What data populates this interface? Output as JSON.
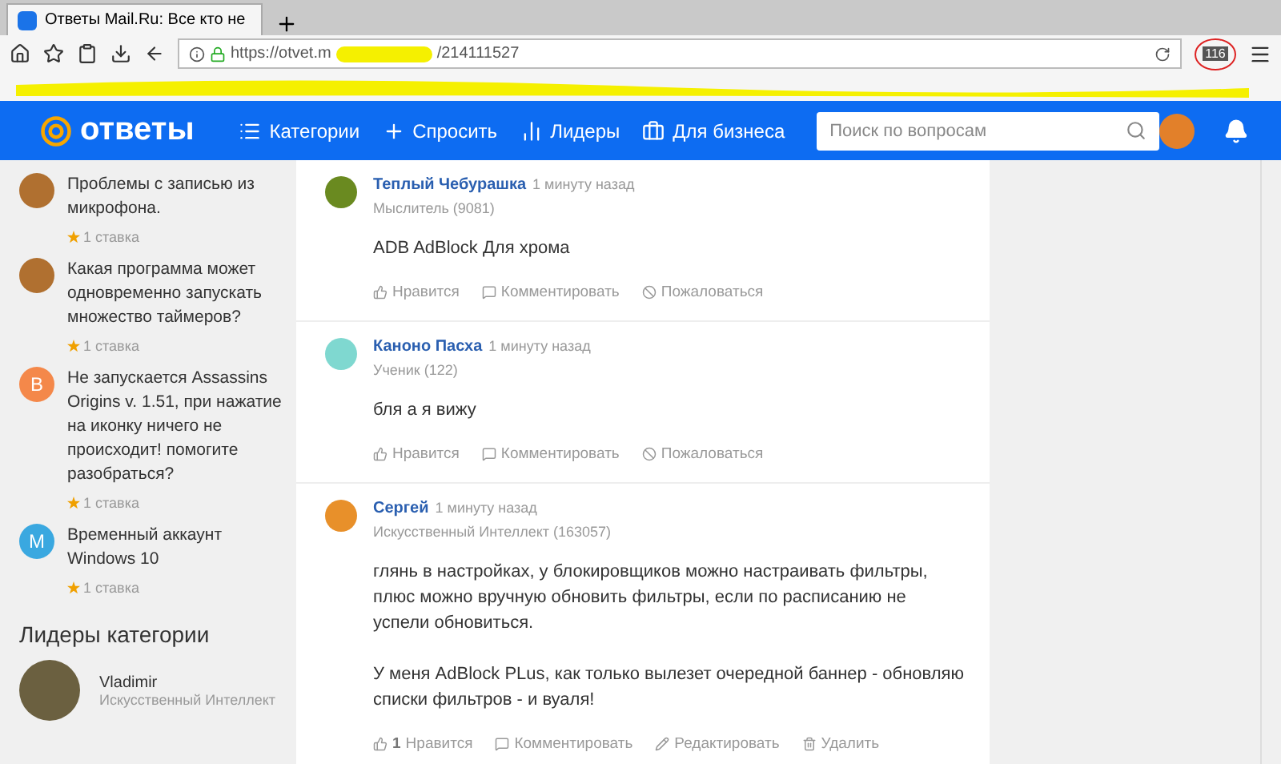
{
  "browser": {
    "tab_title": "Ответы Mail.Ru: Все кто не",
    "url_start": "https://otvet.m",
    "url_end": "/214111527",
    "extension_badge": "116"
  },
  "header": {
    "logo": "ответы",
    "nav": [
      {
        "label": "Категории",
        "kind": "list"
      },
      {
        "label": "Спросить",
        "kind": "plus"
      },
      {
        "label": "Лидеры",
        "kind": "bars"
      },
      {
        "label": "Для бизнеса",
        "kind": "bag"
      }
    ],
    "search": {
      "placeholder": "Поиск по вопросам"
    }
  },
  "sidebar": {
    "questions": [
      {
        "title": "Проблемы с записью из микрофона.",
        "bets": "1 ставка",
        "kind": "photo"
      },
      {
        "title": "Какая программа может одновременно запускать множество таймеров?",
        "bets": "1 ставка",
        "kind": "photo"
      },
      {
        "title": "Не запускается Assassins Origins v. 1.51, при нажатие на иконку ничего не происходит! помогите разобраться?",
        "bets": "1 ставка",
        "kind": "letter",
        "letter": "В",
        "color": "#f4884a"
      },
      {
        "title": "Временный аккаунт Windows 10",
        "bets": "1 ставка",
        "kind": "letter",
        "letter": "М",
        "color": "#3aa8e0"
      }
    ],
    "leaders_title": "Лидеры категории",
    "leaders": [
      {
        "name": "Vladimir",
        "rank": "Искусственный Интеллект"
      }
    ]
  },
  "answers": [
    {
      "author": "Теплый Чебурашка",
      "time": "1 минуту назад",
      "rank": "Мыслитель (9081)",
      "text": [
        "ADB AdBlock Для хрома"
      ],
      "actions": [
        {
          "kind": "like",
          "label": "Нравится"
        },
        {
          "kind": "comment",
          "label": "Комментировать"
        },
        {
          "kind": "report",
          "label": "Пожаловаться"
        }
      ]
    },
    {
      "author": "Каноно Пасха",
      "time": "1 минуту назад",
      "rank": "Ученик (122)",
      "text": [
        "бля а я вижу"
      ],
      "actions": [
        {
          "kind": "like",
          "label": "Нравится"
        },
        {
          "kind": "comment",
          "label": "Комментировать"
        },
        {
          "kind": "report",
          "label": "Пожаловаться"
        }
      ]
    },
    {
      "author": "Сергей",
      "time": "1 минуту назад",
      "rank": "Искусственный Интеллект (163057)",
      "text": [
        "глянь в настройках, у блокировщиков можно настраивать фильтры, плюс можно вручную обновить фильтры, если по расписанию не успели обновиться.",
        "У меня AdBlock PLus, как только вылезет очередной баннер - обновляю списки фильтров - и вуаля!"
      ],
      "actions": [
        {
          "kind": "like",
          "label": "Нравится",
          "count": "1"
        },
        {
          "kind": "comment",
          "label": "Комментировать"
        },
        {
          "kind": "edit",
          "label": "Редактировать"
        },
        {
          "kind": "delete",
          "label": "Удалить"
        }
      ]
    }
  ]
}
